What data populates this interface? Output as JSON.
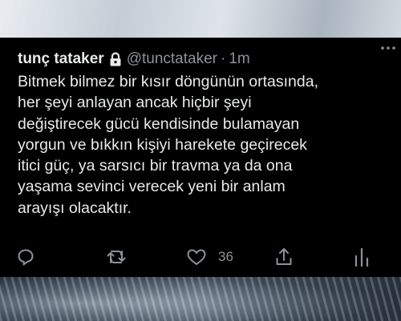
{
  "tweet": {
    "display_name": "tunç tataker",
    "handle": "@tunctataker",
    "separator": "·",
    "time": "1m",
    "text_lines": [
      "Bitmek bilmez bir kısır döngünün ortasında,",
      "her şeyi anlayan ancak hiçbir şeyi",
      "değiştirecek gücü kendisinde bulamayan",
      "yorgun ve bıkkın kişiyi harekete geçirecek",
      "itici güç, ya sarsıcı bir travma ya da ona",
      "yaşama sevinci verecek yeni bir anlam",
      "arayışı olacaktır."
    ],
    "like_count": "36"
  },
  "icons": {
    "lock": "lock-icon",
    "more": "more-icon",
    "reply": "reply-icon",
    "retweet": "retweet-icon",
    "like": "like-icon",
    "share": "share-icon",
    "analytics": "analytics-icon"
  },
  "colors": {
    "background": "#000000",
    "text": "#e7e9ea",
    "secondary_text": "#8b9299"
  }
}
